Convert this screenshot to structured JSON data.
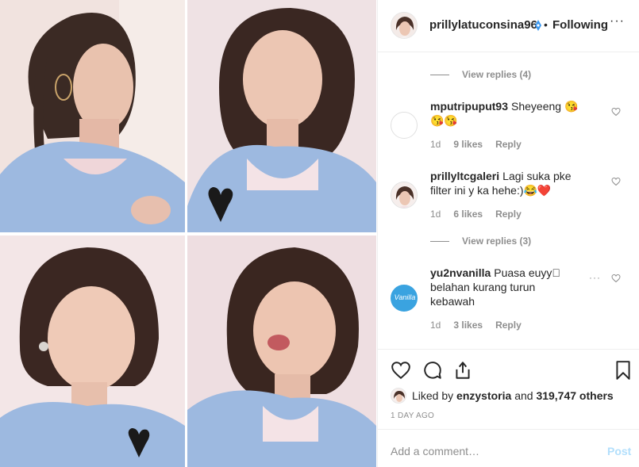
{
  "post": {
    "header": {
      "username": "prillylatuconsina96",
      "dot": "•",
      "follow_status": "Following",
      "more": "···"
    },
    "thread": [
      {
        "type": "replies",
        "label": "View replies (4)"
      },
      {
        "type": "comment",
        "username": "mputripuput93",
        "text": "Sheyeeng 😘😘😘",
        "time": "1d",
        "likes": "9 likes",
        "reply": "Reply"
      },
      {
        "type": "comment",
        "username": "prillyltcgaleri",
        "text": "Lagi suka pke filter ini y ka hehe:)😂❤️",
        "time": "1d",
        "likes": "6 likes",
        "reply": "Reply"
      },
      {
        "type": "replies",
        "label": "View replies (3)"
      },
      {
        "type": "comment",
        "username": "yu2nvanilla",
        "text": "Puasa euyy􀀀 belahan kurang turun kebawah",
        "time": "1d",
        "likes": "3 likes",
        "reply": "Reply",
        "more": "···",
        "avatar_text": "Vanilla"
      }
    ],
    "liked_by_prefix": "Liked by",
    "liked_by_user": "enzystoria",
    "liked_by_and": "and",
    "liked_by_count": "319,747 others",
    "time_ago": "1 DAY AGO",
    "comment_placeholder": "Add a comment…",
    "post_label": "Post"
  },
  "colors": {
    "text": "#262626",
    "secondary": "#8e8e8e",
    "border": "#efefef",
    "verified": "#3897f0",
    "post_disabled": "#b2dffc",
    "dress_blue": "#9db9e0"
  }
}
